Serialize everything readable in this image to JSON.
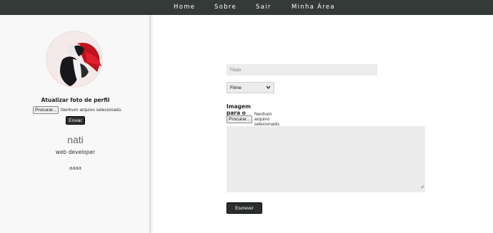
{
  "nav": {
    "items": [
      {
        "label": "Home"
      },
      {
        "label": "Sobre"
      },
      {
        "label": "Sair"
      },
      {
        "label": "Minha Área"
      }
    ]
  },
  "profile": {
    "update_photo_label": "Atualizar foto de perfil",
    "file_button_label": "Procurar...",
    "file_status": "Nenhum arquivo selecionado.",
    "submit_label": "Enviar",
    "username": "nati",
    "role": "web developer",
    "bio": "aaaa"
  },
  "post_form": {
    "title_placeholder": "Título",
    "category_value": "Filme",
    "image_label": "Imagem para o post",
    "file_button_label": "Procurar...",
    "file_status": "Nenhum arquivo selecionado.",
    "write_button_label": "Escrever"
  },
  "colors": {
    "nav_bg": "#343a38",
    "sidebar_bg": "#f8f8f8",
    "field_bg": "#ececec",
    "button_bg": "#2b2f2e"
  }
}
